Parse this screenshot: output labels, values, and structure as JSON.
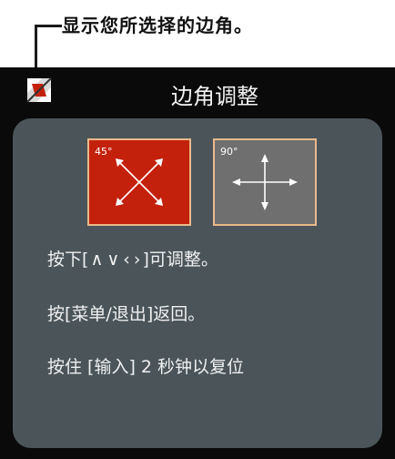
{
  "callout": {
    "text": "显示您所选择的边角。"
  },
  "osd": {
    "title": "边角调整",
    "tiles": [
      {
        "label": "45°",
        "state": "selected",
        "color": "#c4210d"
      },
      {
        "label": "90°",
        "state": "unselected",
        "color": "#6f6f6f"
      }
    ],
    "instructions": {
      "adjust_prefix": "按下",
      "adjust_keys_open": "[",
      "adjust_keys": [
        "∧",
        "∨",
        "‹",
        "›"
      ],
      "adjust_keys_close": "]",
      "adjust_suffix": "可调整。",
      "back": "按[菜单/退出]返回。",
      "reset": "按住 [输入] 2 秒钟以复位"
    }
  }
}
